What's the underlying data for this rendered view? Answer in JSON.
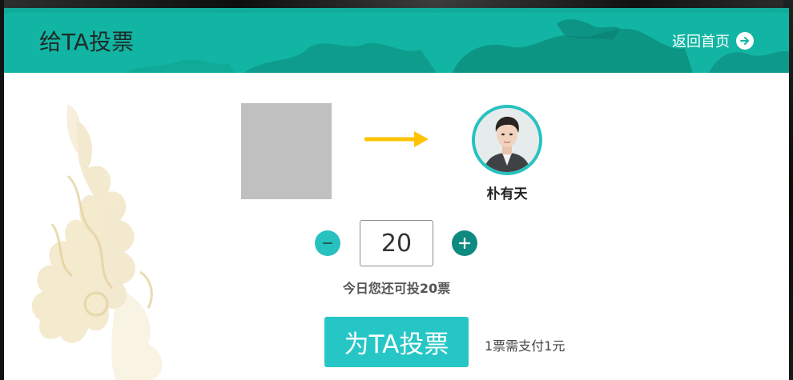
{
  "header": {
    "title": "给TA投票",
    "back_link_label": "返回首页"
  },
  "candidate": {
    "name": "朴有天"
  },
  "vote": {
    "count_value": "20",
    "remaining_text": "今日您还可投20票",
    "submit_label": "为TA投票",
    "price_note": "1票需支付1元"
  },
  "icons": {
    "back": "arrow-right-circle-icon",
    "minus": "minus-icon",
    "plus": "plus-icon",
    "arrow": "arrow-right-icon"
  },
  "colors": {
    "header_teal": "#12b5a3",
    "button_teal": "#27c6c6",
    "plus_dark_teal": "#0f8a80",
    "arrow_yellow": "#ffc300",
    "avatar_ring": "#27c1c0"
  }
}
